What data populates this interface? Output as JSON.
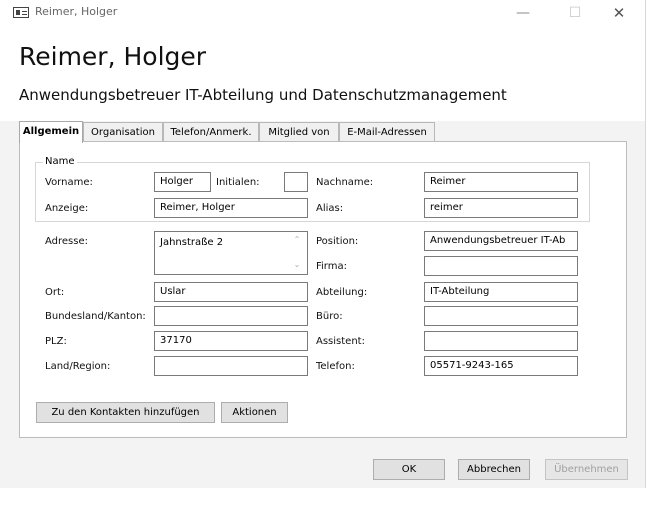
{
  "window": {
    "title": "Reimer, Holger",
    "minimize": "—",
    "maximize": "☐",
    "close": "✕"
  },
  "header": {
    "name": "Reimer, Holger",
    "subtitle": "Anwendungsbetreuer IT-Abteilung und Datenschutzmanagement"
  },
  "tabs": [
    {
      "label": "Allgemein"
    },
    {
      "label": "Organisation"
    },
    {
      "label": "Telefon/Anmerk."
    },
    {
      "label": "Mitglied von"
    },
    {
      "label": "E-Mail-Adressen"
    }
  ],
  "name_group": {
    "label": "Name",
    "vorname_label": "Vorname:",
    "vorname": "Holger",
    "initialen_label": "Initialen:",
    "initialen": "",
    "nachname_label": "Nachname:",
    "nachname": "Reimer",
    "anzeige_label": "Anzeige:",
    "anzeige": "Reimer, Holger",
    "alias_label": "Alias:",
    "alias": "reimer"
  },
  "address": {
    "adresse_label": "Adresse:",
    "adresse": "Jahnstraße 2",
    "ort_label": "Ort:",
    "ort": "Uslar",
    "bundesland_label": "Bundesland/Kanton:",
    "bundesland": "",
    "plz_label": "PLZ:",
    "plz": "37170",
    "land_label": "Land/Region:",
    "land": ""
  },
  "org": {
    "position_label": "Position:",
    "position": "Anwendungsbetreuer IT-Ab",
    "firma_label": "Firma:",
    "firma": "",
    "abteilung_label": "Abteilung:",
    "abteilung": "IT-Abteilung",
    "buero_label": "Büro:",
    "buero": "",
    "assistent_label": "Assistent:",
    "assistent": "",
    "telefon_label": "Telefon:",
    "telefon": "05571-9243-165"
  },
  "actions": {
    "add_contacts": "Zu den Kontakten hinzufügen",
    "aktionen": "Aktionen"
  },
  "footer": {
    "ok": "OK",
    "abbrechen": "Abbrechen",
    "uebernehmen": "Übernehmen"
  }
}
